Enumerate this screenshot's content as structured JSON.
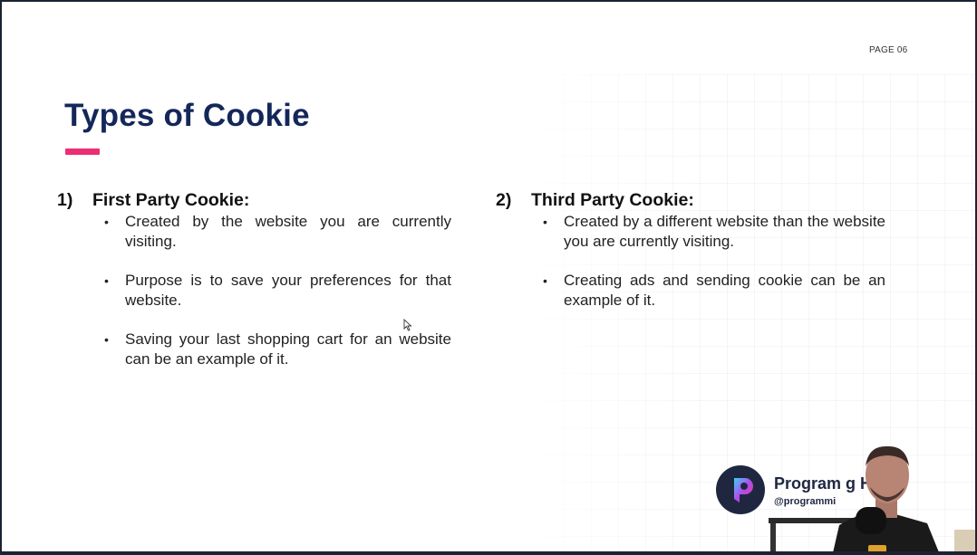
{
  "page": {
    "number_label": "PAGE 06"
  },
  "slide": {
    "title": "Types of Cookie"
  },
  "sections": [
    {
      "number": "1)",
      "heading": "First Party Cookie:",
      "bullets": [
        "Created by the website you are currently visiting.",
        "Purpose is to save your preferences for that website.",
        "Saving your last shopping cart for an website can be an example of it."
      ]
    },
    {
      "number": "2)",
      "heading": "Third Party Cookie:",
      "bullets": [
        "Created by a different website than the website you are currently visiting.",
        "Creating ads and sending cookie can be an example of it."
      ]
    }
  ],
  "overlay": {
    "brand_name": "Program  g Hero",
    "handle": "@programmi"
  },
  "colors": {
    "title": "#14275a",
    "accent": "#ec2e75",
    "brand": "#1f2740"
  }
}
